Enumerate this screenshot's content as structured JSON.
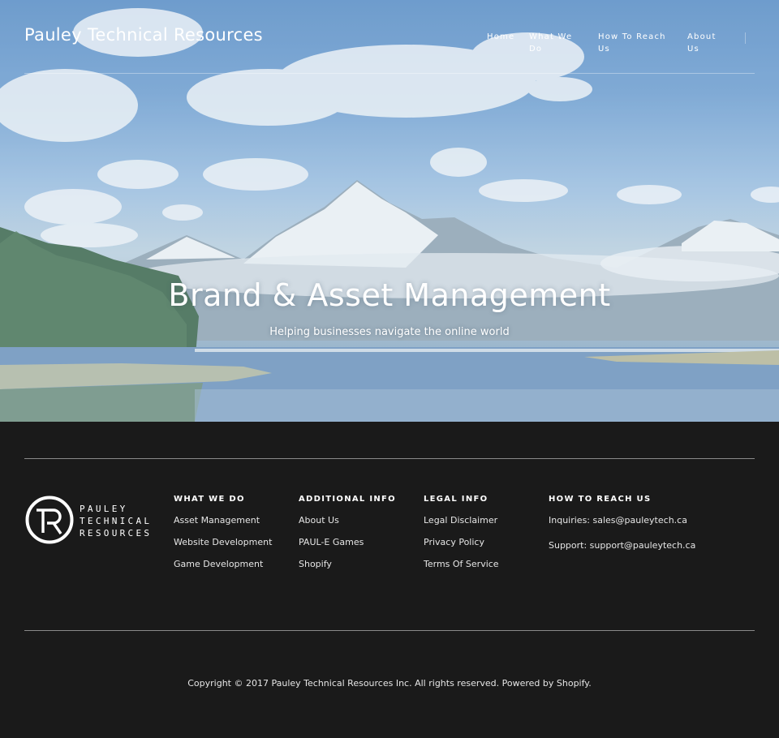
{
  "header": {
    "site_title": "Pauley Technical Resources",
    "nav": [
      {
        "label": "Home"
      },
      {
        "label": "What We Do"
      },
      {
        "label": "How To Reach Us"
      },
      {
        "label": "About Us"
      }
    ]
  },
  "hero": {
    "title": "Brand & Asset Management",
    "subtitle": "Helping businesses navigate the online world"
  },
  "footer": {
    "logo": {
      "monogram": "TR",
      "words": [
        "PAULEY",
        "TECHNICAL",
        "RESOURCES"
      ]
    },
    "columns": [
      {
        "heading": "WHAT WE DO",
        "links": [
          "Asset Management",
          "Website Development",
          "Game Development"
        ]
      },
      {
        "heading": "ADDITIONAL INFO",
        "links": [
          "About Us",
          "PAUL-E Games",
          "Shopify"
        ]
      },
      {
        "heading": "LEGAL INFO",
        "links": [
          "Legal Disclaimer",
          "Privacy Policy",
          "Terms Of Service"
        ]
      },
      {
        "heading": "HOW TO REACH US",
        "contacts": [
          "Inquiries: sales@pauleytech.ca",
          "Support: support@pauleytech.ca"
        ]
      }
    ],
    "copyright": "Copyright © 2017 Pauley Technical Resources Inc. All rights reserved. Powered by Shopify."
  }
}
